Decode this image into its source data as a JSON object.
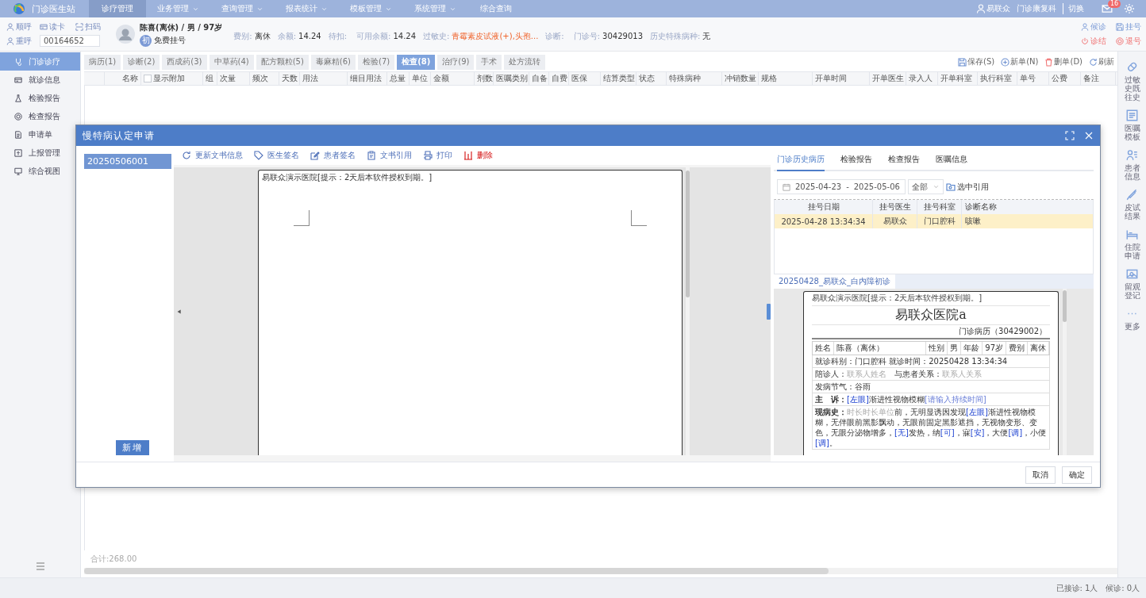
{
  "nav": {
    "app_title": "门诊医生站",
    "menus": [
      {
        "label": "诊疗管理",
        "selected": true,
        "dropdown": false
      },
      {
        "label": "业务管理",
        "selected": false,
        "dropdown": true
      },
      {
        "label": "查询管理",
        "selected": false,
        "dropdown": true
      },
      {
        "label": "报表统计",
        "selected": false,
        "dropdown": true
      },
      {
        "label": "模板管理",
        "selected": false,
        "dropdown": true
      },
      {
        "label": "系统管理",
        "selected": false,
        "dropdown": true
      },
      {
        "label": "综合查询",
        "selected": false,
        "dropdown": false
      }
    ],
    "user": "易联众",
    "department": "门诊康复科",
    "switch": "切换",
    "mail_badge": "16"
  },
  "patient_bar": {
    "tools": [
      {
        "label": "顺呼"
      },
      {
        "label": "读卡"
      },
      {
        "label": "扫码"
      },
      {
        "label": "重呼"
      }
    ],
    "card_field": {
      "value": "00164652"
    },
    "name_line": "陈喜(离休) / 男 / 97岁",
    "visit_badge": "初",
    "visit_type": "免费挂号",
    "fields": [
      {
        "label": "费别:",
        "value": "离休",
        "kind": "plain"
      },
      {
        "label": "余额:",
        "value": "14.24",
        "kind": "plain"
      },
      {
        "label": "待扣:"
      },
      {
        "label": "可用余额:",
        "value": "14.24",
        "kind": "plain"
      },
      {
        "label": "过敏史:",
        "value": "青霉素皮试液(+),头孢...",
        "kind": "alert"
      },
      {
        "label": "诊断:"
      },
      {
        "label": "门诊号:",
        "value": "30429013",
        "kind": "plain"
      },
      {
        "label": "历史特殊病种:",
        "value": "无",
        "kind": "plain"
      }
    ],
    "actions": [
      {
        "label": "候诊",
        "kind": "normal"
      },
      {
        "label": "挂号",
        "kind": "normal"
      },
      {
        "label": "诊结",
        "kind": "danger"
      },
      {
        "label": "退号",
        "kind": "danger"
      }
    ]
  },
  "sidebar": {
    "items": [
      {
        "label": "门诊诊疗",
        "selected": true
      },
      {
        "label": "就诊信息",
        "selected": false
      },
      {
        "label": "检验报告",
        "selected": false
      },
      {
        "label": "检查报告",
        "selected": false
      },
      {
        "label": "申请单",
        "selected": false
      },
      {
        "label": "上报管理",
        "selected": false
      },
      {
        "label": "综合视图",
        "selected": false
      }
    ]
  },
  "order_tabs": [
    {
      "label": "病历(1)",
      "selected": false
    },
    {
      "label": "诊断(2)",
      "selected": false
    },
    {
      "label": "西成药(3)",
      "selected": false
    },
    {
      "label": "中草药(4)",
      "selected": false
    },
    {
      "label": "配方颗粒(5)",
      "selected": false
    },
    {
      "label": "毒麻精(6)",
      "selected": false
    },
    {
      "label": "检验(7)",
      "selected": false
    },
    {
      "label": "检查(8)",
      "selected": true
    },
    {
      "label": "治疗(9)",
      "selected": false
    },
    {
      "label": "手术",
      "selected": false
    },
    {
      "label": "处方流转",
      "selected": false
    }
  ],
  "order_actions": [
    {
      "label": "保存(S)",
      "kind": "normal"
    },
    {
      "label": "新单(N)",
      "kind": "normal"
    },
    {
      "label": "删单(D)",
      "kind": "danger"
    },
    {
      "label": "刷新",
      "kind": "normal"
    }
  ],
  "table": {
    "columns": [
      {
        "label": "名称",
        "kind": "text"
      },
      {
        "label": "显示附加",
        "kind": "checkbox",
        "checked": false
      },
      {
        "label": "组",
        "kind": "text"
      },
      {
        "label": "次量",
        "kind": "text"
      },
      {
        "label": "频次",
        "kind": "text"
      },
      {
        "label": "天数",
        "kind": "text"
      },
      {
        "label": "用法",
        "kind": "text"
      },
      {
        "label": "细目用法",
        "kind": "text"
      },
      {
        "label": "总量",
        "kind": "text"
      },
      {
        "label": "单位",
        "kind": "text"
      },
      {
        "label": "金额",
        "kind": "text"
      },
      {
        "label": "剂数",
        "kind": "text"
      },
      {
        "label": "医嘱类别",
        "kind": "text"
      },
      {
        "label": "自备",
        "kind": "text"
      },
      {
        "label": "自费",
        "kind": "text"
      },
      {
        "label": "医保",
        "kind": "text"
      },
      {
        "label": "结算类型",
        "kind": "text"
      },
      {
        "label": "状态",
        "kind": "text"
      },
      {
        "label": "特殊病种",
        "kind": "text"
      },
      {
        "label": "冲销数量",
        "kind": "text"
      },
      {
        "label": "规格",
        "kind": "text"
      },
      {
        "label": "开单时间",
        "kind": "text"
      },
      {
        "label": "开单医生",
        "kind": "text"
      },
      {
        "label": "录入人",
        "kind": "text"
      },
      {
        "label": "开单科室",
        "kind": "text"
      },
      {
        "label": "执行科室",
        "kind": "text"
      },
      {
        "label": "单号",
        "kind": "text"
      },
      {
        "label": "公费",
        "kind": "text"
      },
      {
        "label": "备注",
        "kind": "text"
      }
    ],
    "total": "合计:268.00"
  },
  "right_rail": [
    {
      "label": "过敏史既往史"
    },
    {
      "label": "医嘱模板"
    },
    {
      "label": "患者信息"
    },
    {
      "label": "皮试结果"
    },
    {
      "label": "住院申请"
    },
    {
      "label": "留观登记"
    },
    {
      "label": "更多"
    }
  ],
  "status_bar": [
    {
      "label": "已接诊:",
      "value": "1人"
    },
    {
      "label": "候诊:",
      "value": "0人"
    }
  ],
  "dialog": {
    "title": "慢特病认定申请",
    "records": [
      {
        "label": "20250506001",
        "selected": true
      }
    ],
    "add_button": "新增",
    "toolbar": [
      {
        "label": "更新文书信息",
        "kind": "normal"
      },
      {
        "label": "医生签名",
        "kind": "normal"
      },
      {
        "label": "患者签名",
        "kind": "normal"
      },
      {
        "label": "文书引用",
        "kind": "normal"
      },
      {
        "label": "打印",
        "kind": "normal"
      },
      {
        "label": "删除",
        "kind": "danger"
      }
    ],
    "document_header": "易联众演示医院[提示：2天后本软件授权到期。]",
    "history": {
      "tabs": [
        {
          "label": "门诊历史病历",
          "selected": true
        },
        {
          "label": "检验报告",
          "selected": false
        },
        {
          "label": "检查报告",
          "selected": false
        },
        {
          "label": "医嘱信息",
          "selected": false
        }
      ],
      "date_from": "2025-04-23",
      "date_separator": "-",
      "date_to": "2025-05-06",
      "filter": "全部",
      "quote_button": "选中引用",
      "columns": [
        "挂号日期",
        "挂号医生",
        "挂号科室",
        "诊断名称"
      ],
      "rows": [
        {
          "cells": [
            "2025-04-28 13:34:34",
            "易联众",
            "门口腔科",
            "咳嗽"
          ],
          "selected": true
        }
      ],
      "doc_tabs": [
        {
          "label": "20250428_易联众_白内障初诊",
          "selected": true
        }
      ],
      "preview": {
        "header": "易联众演示医院[提示：2天后本软件授权到期。]",
        "hospital": "易联众医院a",
        "record_title": "门诊病历（30429002）",
        "info": [
          "姓名",
          "陈喜（离休）",
          "性别",
          "男",
          "年龄",
          "97岁",
          "费别",
          "离休"
        ],
        "lines": [
          {
            "parts": [
              {
                "text": "就诊科别：",
                "kind": "label"
              },
              {
                "text": "门口腔科",
                "kind": "text"
              },
              {
                "text": " 就诊时间：",
                "kind": "label"
              },
              {
                "text": "20250428 13:34:34",
                "kind": "text"
              }
            ]
          },
          {
            "parts": [
              {
                "text": "陪诊人：",
                "kind": "label"
              },
              {
                "text": "联系人姓名",
                "kind": "hint"
              },
              {
                "text": "　与患者关系：",
                "kind": "label"
              },
              {
                "text": "联系人关系",
                "kind": "hint"
              }
            ]
          },
          {
            "parts": [
              {
                "text": "发病节气：",
                "kind": "label"
              },
              {
                "text": "谷雨",
                "kind": "text"
              }
            ]
          },
          {
            "parts": [
              {
                "text": "主　诉：",
                "kind": "strong"
              },
              {
                "text": "[左眼]",
                "kind": "field"
              },
              {
                "text": "渐进性视物模糊",
                "kind": "text"
              },
              {
                "text": "[请输入持续时间]",
                "kind": "hint_field"
              }
            ]
          },
          {
            "parts": [
              {
                "text": "现病史：",
                "kind": "strong"
              },
              {
                "text": "时长时长单位",
                "kind": "hint"
              },
              {
                "text": "前，无明显诱因发现",
                "kind": "text"
              },
              {
                "text": "[左眼]",
                "kind": "field"
              },
              {
                "text": "渐进性视物模糊，无伴眼前黑影飘动，无眼前固定黑影遮挡，无视物变形、变色，无眼分泌物增多，",
                "kind": "text"
              },
              {
                "text": "[无]",
                "kind": "field"
              },
              {
                "text": "发热，纳",
                "kind": "text"
              },
              {
                "text": "[可]",
                "kind": "field"
              },
              {
                "text": "，寐",
                "kind": "text"
              },
              {
                "text": "[安]",
                "kind": "field"
              },
              {
                "text": "，大便",
                "kind": "text"
              },
              {
                "text": "[调]",
                "kind": "field"
              },
              {
                "text": "，小便",
                "kind": "text"
              },
              {
                "text": "[调]",
                "kind": "field"
              },
              {
                "text": "。",
                "kind": "text"
              }
            ]
          }
        ]
      }
    },
    "buttons": [
      "取消",
      "确定"
    ]
  }
}
